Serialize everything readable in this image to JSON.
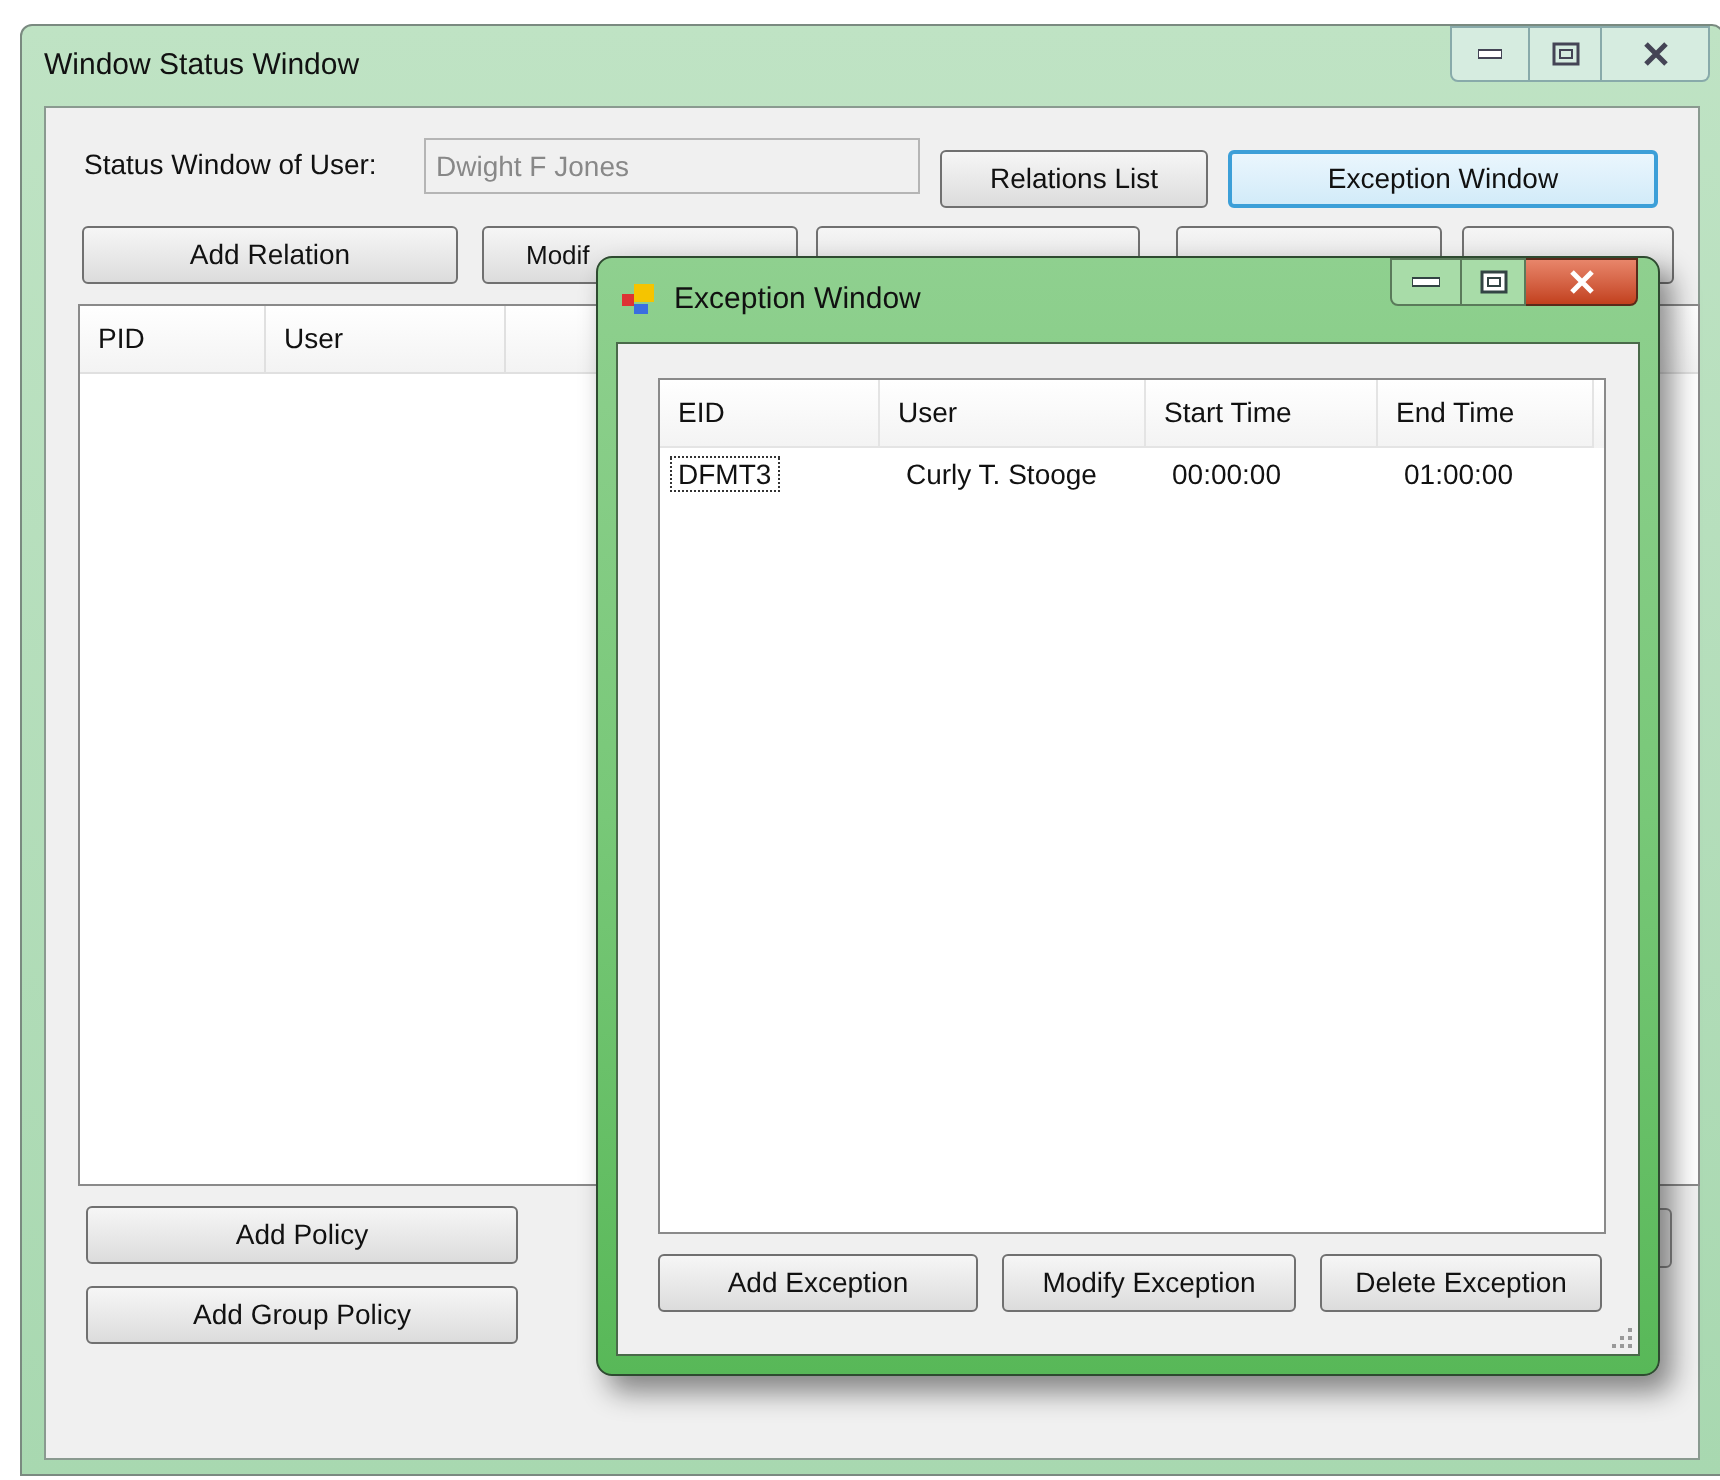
{
  "main_window": {
    "title": "Window Status Window",
    "user_label": "Status Window of User:",
    "user_field": {
      "value": "Dwight F Jones",
      "disabled": true
    },
    "top_buttons": [
      {
        "label": "Relations List",
        "focused": false
      },
      {
        "label": "Exception Window",
        "focused": true
      }
    ],
    "relation_buttons": [
      "Add Relation",
      "Modif"
    ],
    "list_columns": [
      "PID",
      "User"
    ],
    "policy_buttons": [
      "Add Policy",
      "Add Group Policy"
    ]
  },
  "exception_window": {
    "title": "Exception Window",
    "columns": [
      "EID",
      "User",
      "Start Time",
      "End Time"
    ],
    "rows": [
      {
        "cells": [
          "DFMT3",
          "Curly T. Stooge",
          "00:00:00",
          "01:00:00"
        ],
        "focused": true
      }
    ],
    "buttons": [
      "Add Exception",
      "Modify Exception",
      "Delete Exception"
    ]
  }
}
